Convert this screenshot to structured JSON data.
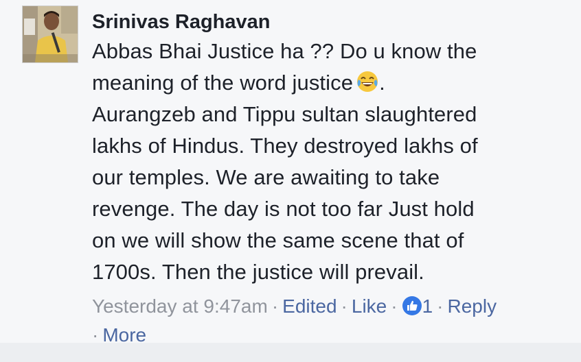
{
  "comment": {
    "author": "Srinivas Raghavan",
    "lines": [
      "Abbas Bhai Justice ha ?? Do u know the",
      "meaning of the word justice",
      "Aurangzeb and Tippu sultan slaughtered",
      "lakhs of Hindus. They destroyed lakhs of",
      "our temples. We are awaiting to take",
      "revenge. The day is not too far Just hold",
      "on we will show the same scene that of",
      "1700s. Then the justice will prevail."
    ],
    "line2_suffix": ".",
    "emoji_icon": "laughing-tears-emoji-icon",
    "meta": {
      "timestamp": "Yesterday at 9:47am",
      "edited": "Edited",
      "like": "Like",
      "like_count": "1",
      "reply": "Reply",
      "more": "More",
      "separator": "·"
    }
  },
  "colors": {
    "background": "#f6f7f9",
    "text": "#1d2129",
    "meta": "#90949c",
    "link": "#4b67a1",
    "like_blue": "#3578e5"
  }
}
